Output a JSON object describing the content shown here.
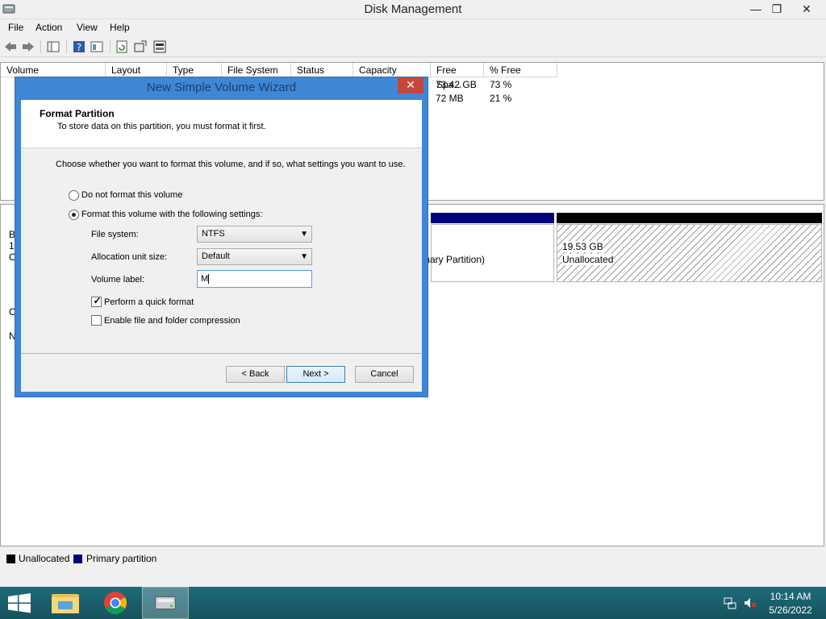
{
  "window": {
    "title": "Disk Management",
    "minimize_glyph": "—",
    "maximize_glyph": "❐",
    "close_glyph": "✕"
  },
  "menu": [
    "File",
    "Action",
    "View",
    "Help"
  ],
  "toolbar": {
    "icons": [
      "back-icon",
      "forward-icon",
      "console-tree-icon",
      "help-icon",
      "properties-icon",
      "refresh-icon",
      "rescan-disks-icon",
      "disk-properties-icon"
    ]
  },
  "volume_list": {
    "columns": [
      "Volume",
      "Layout",
      "Type",
      "File System",
      "Status",
      "Capacity",
      "Free Spa...",
      "% Free"
    ],
    "rows": [
      {
        "free_space": "73.42 GB",
        "percent_free": "73 %"
      },
      {
        "free_space": "72 MB",
        "percent_free": "21 %"
      }
    ]
  },
  "disk_map": {
    "left_labels": [
      "B",
      "1",
      "C",
      "C",
      "N"
    ],
    "primary_partition_text": "mary Partition)",
    "unallocated_size": "19.53 GB",
    "unallocated_label": "Unallocated"
  },
  "legend": {
    "unallocated": "Unallocated",
    "primary": "Primary partition",
    "unallocated_color": "#000000",
    "primary_color": "#00007c"
  },
  "dialog": {
    "title": "New Simple Volume Wizard",
    "close_glyph": "✕",
    "heading": "Format Partition",
    "subheading": "To store data on this partition, you must format it first.",
    "instruction": "Choose whether you want to format this volume, and if so, what settings you want to use.",
    "option_no_format": "Do not format this volume",
    "option_format": "Format this volume with the following settings:",
    "file_system_label": "File system:",
    "file_system_value": "NTFS",
    "allocation_label": "Allocation unit size:",
    "allocation_value": "Default",
    "volume_label_label": "Volume label:",
    "volume_label_value": "M",
    "quick_format_label": "Perform a quick format",
    "quick_format_checked": true,
    "compression_label": "Enable file and folder compression",
    "compression_checked": false,
    "back_button": "< Back",
    "next_button": "Next >",
    "cancel_button": "Cancel"
  },
  "taskbar": {
    "apps": [
      "start-icon",
      "file-explorer-icon",
      "chrome-icon",
      "disk-management-icon"
    ],
    "time": "10:14 AM",
    "date": "5/26/2022"
  }
}
